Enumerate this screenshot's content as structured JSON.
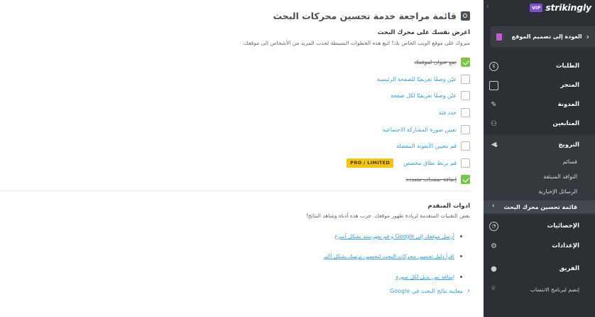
{
  "main": {
    "title": "قائمة مراجعة خدمة تحسين محركات البحث",
    "section1": {
      "heading": "اعرض نفسك على محرك البحث",
      "description": "مبروك على موقع الويب الخاص بك! اتبع هذه الخطوات البسيطة لجذب المزيد من الأشخاص إلى موقعك."
    },
    "checklist": [
      {
        "label": "ضع عنوان لموقعك",
        "done": true
      },
      {
        "label": "عيّن وصفًا تعريفيًا للصفحة الرئيسية",
        "done": false
      },
      {
        "label": "عيّن وصفًا تعريفيًا لكل صفحة",
        "done": false
      },
      {
        "label": "حدد فئة",
        "done": false
      },
      {
        "label": "تعيين صورة المشاركة الاجتماعية",
        "done": false
      },
      {
        "label": "قم بتعيين الأيقونة المفضلة",
        "done": false
      },
      {
        "label": "قم بربط نطاق مخصص",
        "done": false,
        "badge": "PRO / LIMITED"
      },
      {
        "label": "إضافة صفحات متعددة",
        "done": true
      }
    ],
    "section2": {
      "heading": "ادوات المتقدم",
      "description": "بعض التقنيات المتقدمة لزيادة ظهور موقعك. جرب هذه أدناه وشاهد النتائج!"
    },
    "tools": [
      {
        "label": "أرسل موقعك إلى Google و قم بفهرسته بشكل أسرع"
      },
      {
        "label": "اقرأ دليل تحسين محركات البحث لتحسين ترتيبك بشكل أكبر"
      },
      {
        "label": "إضافة نص بديل لكل صورة"
      }
    ],
    "preview_link": "معاينة نتائج البحث في Google"
  },
  "sidebar": {
    "vip": "VIP",
    "logo": "strikingly",
    "back_label": "العودة إلى تصميم الموقع",
    "items": [
      {
        "label": "الطلبات",
        "icon": "dollar-icon"
      },
      {
        "label": "المتجر",
        "icon": "store-icon"
      },
      {
        "label": "المدونة",
        "icon": "pen-icon"
      },
      {
        "label": "المتابعين",
        "icon": "users-icon"
      }
    ],
    "promo": {
      "label": "الترويج",
      "icon": "megaphone-icon",
      "subitems": [
        "قسائم",
        "النوافذ المنبثقة",
        "الرسائل الإخبارية"
      ],
      "active": "قائمة تحسين محرك البحث"
    },
    "items_after": [
      {
        "label": "الإحصائيات",
        "icon": "chart-icon"
      },
      {
        "label": "الإعدادات",
        "icon": "gear-icon"
      },
      {
        "label": "الفريق",
        "icon": "team-icon"
      }
    ],
    "affiliate": "إنضم لبرنامج الانتساب"
  },
  "colors": {
    "accent": "#3c9ed6",
    "check": "#7cc34a",
    "badge": "#f2c413",
    "sidebar_bg": "#2c2f33",
    "vip": "#7c4fd0"
  }
}
